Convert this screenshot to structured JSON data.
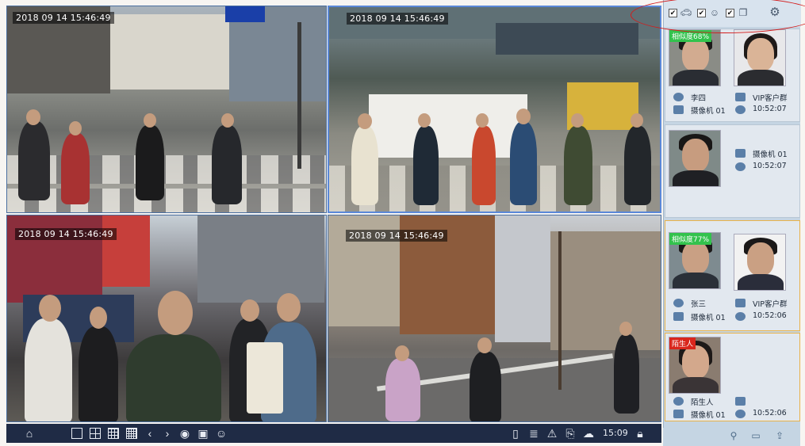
{
  "cameras": [
    {
      "id": "cam1",
      "timestamp": "2018 09 14 15:46:49"
    },
    {
      "id": "cam2",
      "timestamp": "2018 09 14 15:46:49"
    },
    {
      "id": "cam3",
      "timestamp": "2018 09 14 15:46:49"
    },
    {
      "id": "cam4",
      "timestamp": "2018 09 14 15:46:49"
    }
  ],
  "toolbar": {
    "clock": "15:09",
    "icons": [
      "home-icon",
      "layout-1-icon",
      "layout-4-icon",
      "layout-9-icon",
      "layout-16-icon",
      "prev-icon",
      "next-icon",
      "snapshot-icon",
      "record-icon",
      "face-capture-icon",
      "sd-card-icon",
      "document-icon",
      "alarm-icon",
      "export-icon",
      "cloud-icon",
      "lock-icon"
    ]
  },
  "panel": {
    "filters": [
      "person-icon",
      "vehicle-icon",
      "face-icon",
      "stack-icon"
    ],
    "cards": [
      {
        "similarity": "相似度68%",
        "name": "李四",
        "group": "VIP客户群",
        "camera": "摄像机 01",
        "time": "10:52:07"
      },
      {
        "camera": "摄像机 01",
        "time": "10:52:07"
      },
      {
        "similarity": "相似度77%",
        "name": "张三",
        "group": "VIP客户群",
        "camera": "摄像机 01",
        "time": "10:52:06"
      },
      {
        "similarity": "陌生人",
        "name": "陌生人",
        "camera": "摄像机 01",
        "time": "10:52:06"
      }
    ],
    "colors": {
      "match": "#33c24d",
      "stranger": "#d9261c",
      "selected_border": "#e8b24a",
      "annotation": "#d41a1a"
    }
  }
}
